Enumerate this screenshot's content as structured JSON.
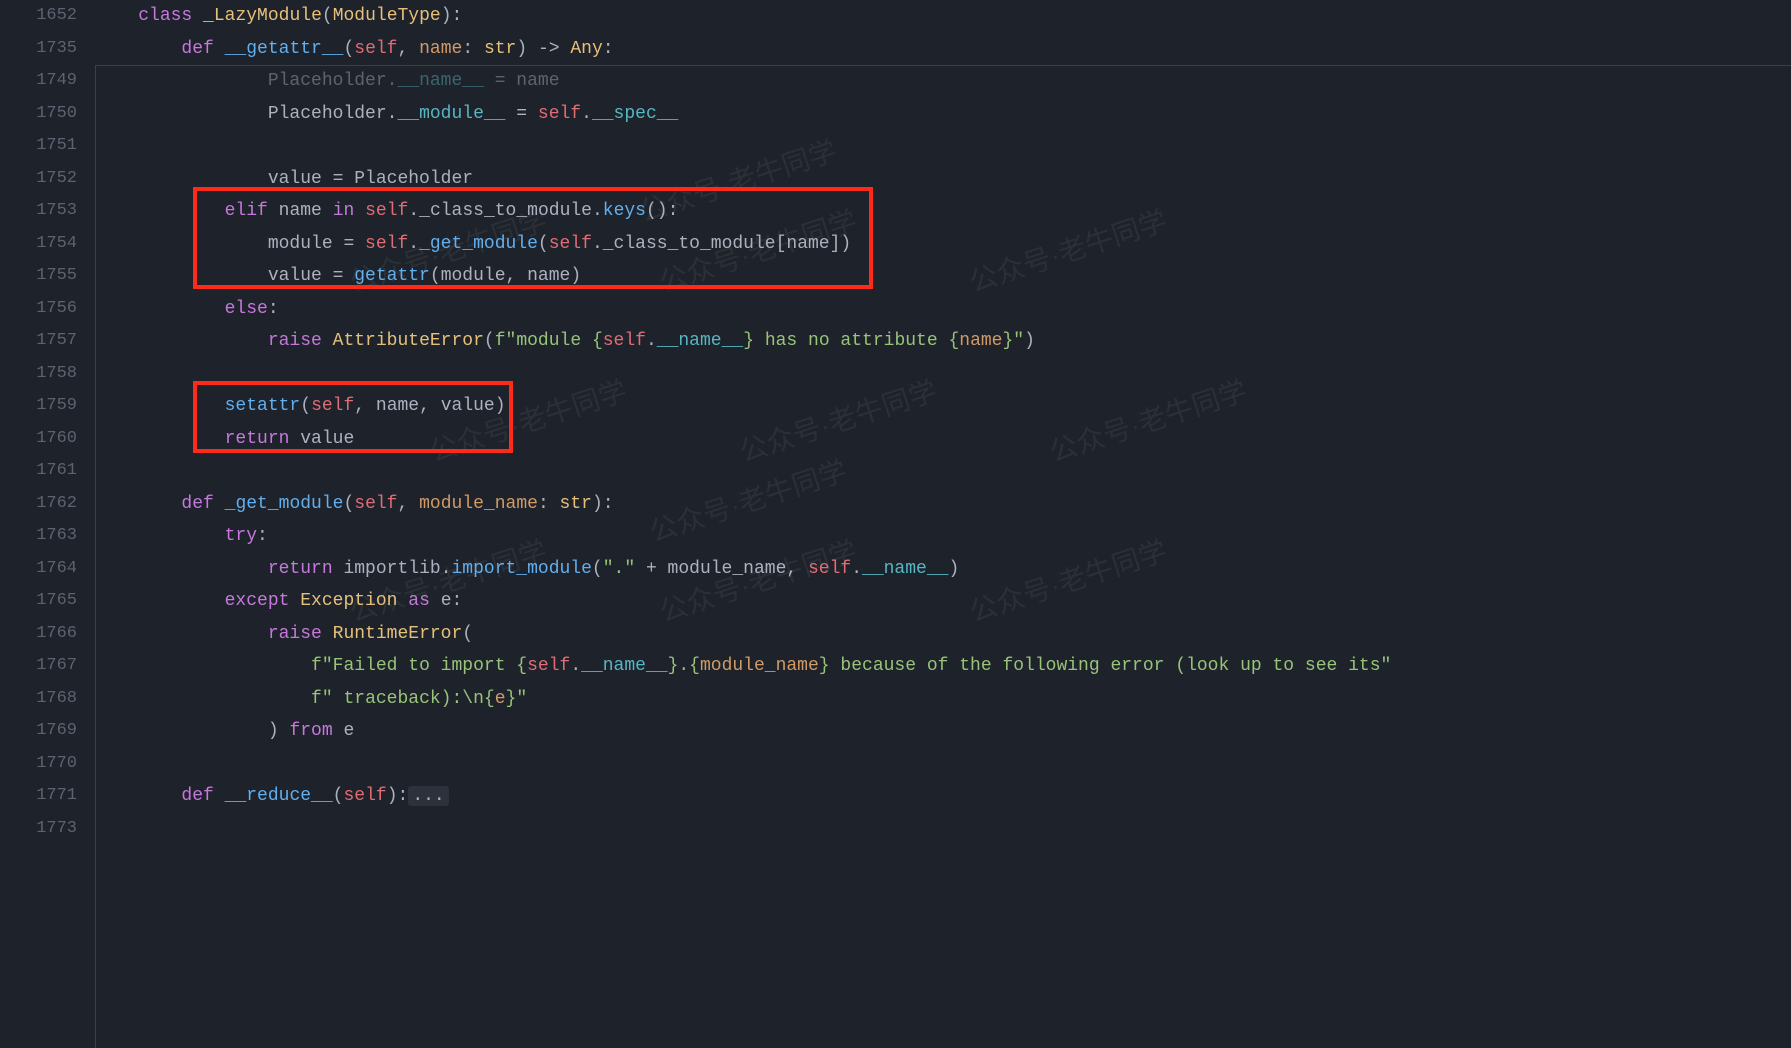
{
  "sticky_lines": [
    {
      "num": 1652
    },
    {
      "num": 1735
    }
  ],
  "lines": [
    {
      "num": 1749
    },
    {
      "num": 1750
    },
    {
      "num": 1751
    },
    {
      "num": 1752
    },
    {
      "num": 1753
    },
    {
      "num": 1754
    },
    {
      "num": 1755
    },
    {
      "num": 1756
    },
    {
      "num": 1757
    },
    {
      "num": 1758
    },
    {
      "num": 1759
    },
    {
      "num": 1760
    },
    {
      "num": 1761
    },
    {
      "num": 1762
    },
    {
      "num": 1763
    },
    {
      "num": 1764
    },
    {
      "num": 1765
    },
    {
      "num": 1766
    },
    {
      "num": 1767
    },
    {
      "num": 1768
    },
    {
      "num": 1769
    },
    {
      "num": 1770
    },
    {
      "num": 1771
    },
    {
      "num": 1773
    }
  ],
  "tokens": {
    "class_kw": "class",
    "def_kw": "def",
    "elif_kw": "elif",
    "else_kw": "else",
    "raise_kw": "raise",
    "return_kw": "return",
    "try_kw": "try",
    "except_kw": "except",
    "as_kw": "as",
    "from_kw": "from",
    "in_kw": "in",
    "self": "self",
    "LazyModule": "_LazyModule",
    "ModuleType": "ModuleType",
    "getattr_dun": "__getattr__",
    "reduce_dun": "__reduce__",
    "name": "name",
    "str_t": "str",
    "Any": "Any",
    "Placeholder": "Placeholder",
    "name_dun": "__name__",
    "module_dun": "__module__",
    "spec_dun": "__spec__",
    "value": "value",
    "class_to_module": "_class_to_module",
    "keys": "keys",
    "module": "module",
    "get_module": "_get_module",
    "getattr_fn": "getattr",
    "setattr_fn": "setattr",
    "AttributeError": "AttributeError",
    "fstr_mod": "module ",
    "fstr_hasno": " has no attribute ",
    "module_name": "module_name",
    "importlib": "importlib",
    "import_module": "import_module",
    "dot_str": "\".\"",
    "Exception": "Exception",
    "e": "e",
    "RuntimeError": "RuntimeError",
    "fail_str1": "\"Failed to import ",
    "fail_str1_end": " because of the following error (look up to see its\"",
    "fail_str2": "\" traceback):\\n",
    "fold_dots": "..."
  },
  "watermark_text": "公众号·老牛同学"
}
